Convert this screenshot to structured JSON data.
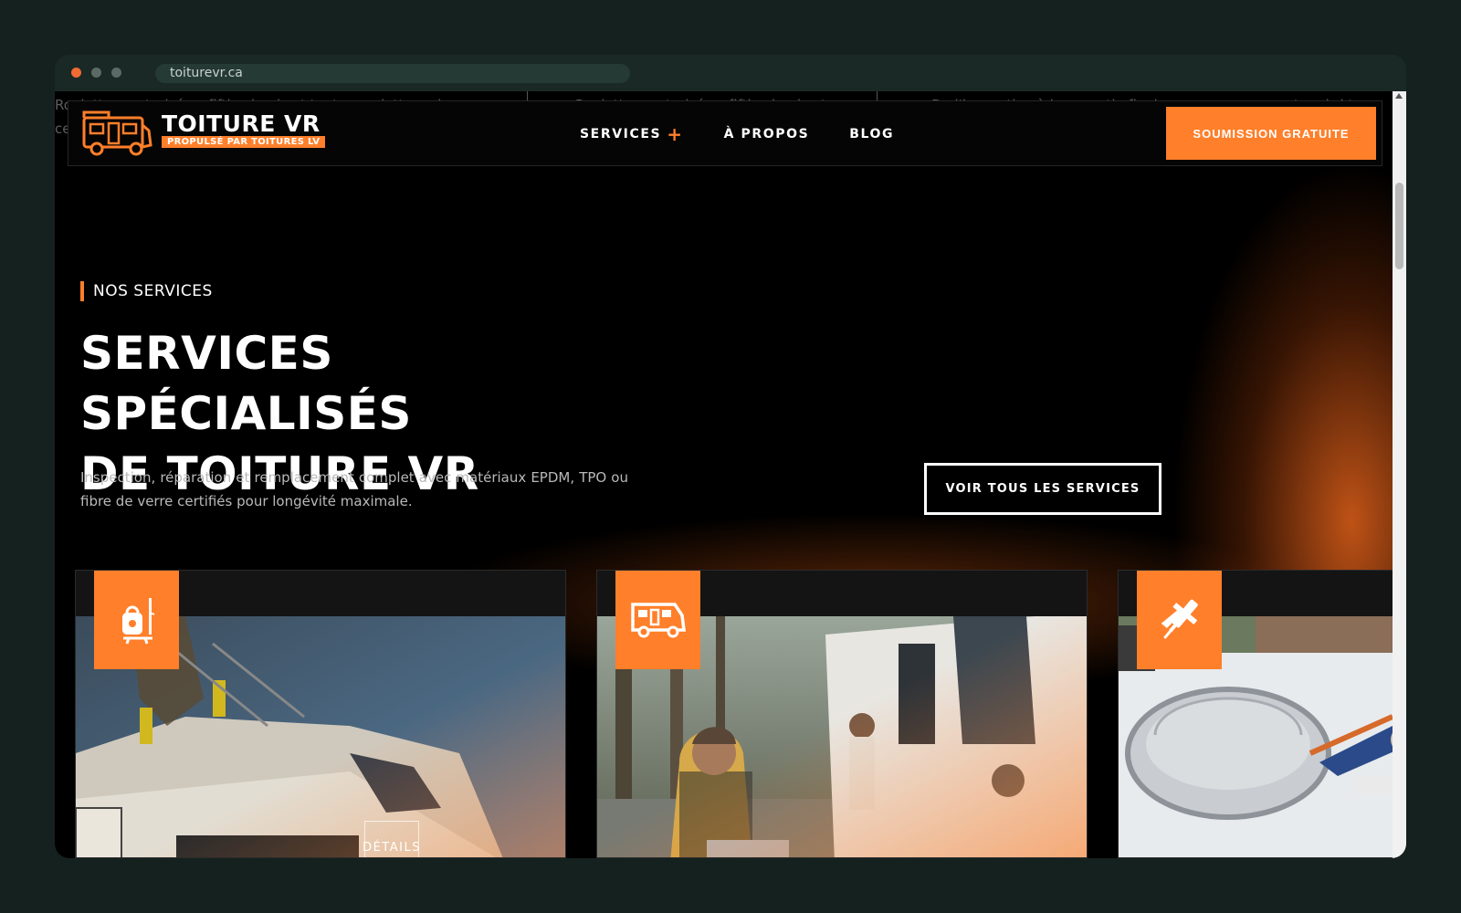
{
  "browser": {
    "url": "toiturevr.ca"
  },
  "ghost_text": {
    "col1": "Roulottes motorisées, fifth wheels et tentes-roulottes : des",
    "col1_line2": "ce",
    "col2": "Roulottes motorisées, fifth wheels et",
    "col3": "De l'inspection à la garantie finale, nous assurons votre abri tout"
  },
  "header": {
    "logo_title": "TOITURE VR",
    "logo_subtitle": "PROPULSÉ PAR TOITURES LV",
    "nav": [
      {
        "label": "SERVICES"
      },
      {
        "label": "À PROPOS"
      },
      {
        "label": "BLOG"
      }
    ],
    "cta_label": "SOUMISSION GRATUITE"
  },
  "hero": {
    "eyebrow": "NOS SERVICES",
    "title_line1": "SERVICES SPÉCIALISÉS",
    "title_line2": "DE TOITURE VR",
    "lead": "Inspection, réparation et remplacement complet avec matériaux EPDM, TPO ou fibre de verre certifiés pour longévité maximale.",
    "button_label": "VOIR TOUS LES SERVICES"
  },
  "cards": [
    {
      "icon": "pressure-washer-icon",
      "details_label": "DÉTAILS"
    },
    {
      "icon": "rv-camper-icon"
    },
    {
      "icon": "caulking-gun-icon"
    }
  ],
  "colors": {
    "accent": "#ff7f2a",
    "background": "#000000",
    "frame": "#15211e"
  }
}
